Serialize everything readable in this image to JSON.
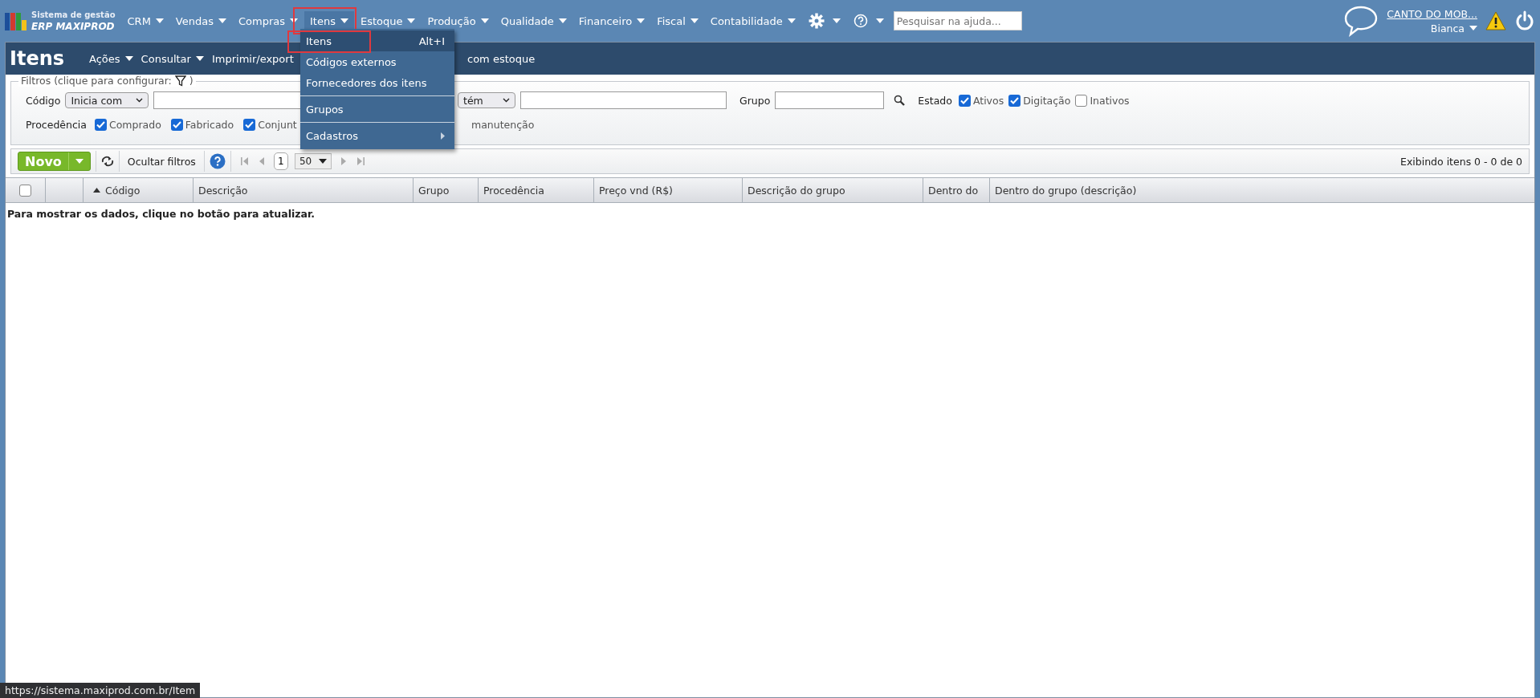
{
  "app": {
    "logo_line1": "Sistema de gestão",
    "logo_line2": "ERP MAXIPROD"
  },
  "top_menu": [
    {
      "label": "CRM",
      "selected": false,
      "annotated": false
    },
    {
      "label": "Vendas",
      "selected": false,
      "annotated": false
    },
    {
      "label": "Compras",
      "selected": false,
      "annotated": false
    },
    {
      "label": "Itens",
      "selected": true,
      "annotated": true
    },
    {
      "label": "Estoque",
      "selected": false,
      "annotated": false
    },
    {
      "label": "Produção",
      "selected": false,
      "annotated": false
    },
    {
      "label": "Qualidade",
      "selected": false,
      "annotated": false
    },
    {
      "label": "Financeiro",
      "selected": false,
      "annotated": false
    },
    {
      "label": "Fiscal",
      "selected": false,
      "annotated": false
    },
    {
      "label": "Contabilidade",
      "selected": false,
      "annotated": false
    }
  ],
  "top_icons": [
    {
      "kind": "gear"
    },
    {
      "kind": "help"
    }
  ],
  "help_search": {
    "placeholder": "Pesquisar na ajuda..."
  },
  "account": {
    "company": "CANTO DO MOB...",
    "user": "Bianca"
  },
  "page": {
    "title": "Itens",
    "actions": [
      {
        "label": "Ações",
        "dropdown": true
      },
      {
        "label": "Consultar",
        "dropdown": true
      },
      {
        "label": "Imprimir/export",
        "dropdown": false
      }
    ],
    "hidden_action_tail": "com estoque"
  },
  "dropdown_menu": [
    {
      "kind": "item",
      "label": "Itens",
      "shortcut": "Alt+I",
      "selected": true,
      "annotated": true
    },
    {
      "kind": "item",
      "label": "Códigos externos",
      "selected": false,
      "annotated": false
    },
    {
      "kind": "item",
      "label": "Fornecedores dos itens",
      "selected": false,
      "annotated": false
    },
    {
      "kind": "separator"
    },
    {
      "kind": "item",
      "label": "Grupos",
      "selected": false,
      "annotated": false
    },
    {
      "kind": "separator"
    },
    {
      "kind": "submenu",
      "label": "Cadastros",
      "selected": false,
      "annotated": false
    }
  ],
  "filters": {
    "legend": "Filtros (clique para configurar:",
    "legend_end": ")",
    "code_label": "Código",
    "code_mode": "Inicia com",
    "desc_mode": "tém",
    "group_label": "Grupo",
    "state_label": "Estado",
    "states": [
      {
        "label": "Ativos",
        "checked": true
      },
      {
        "label": "Digitação",
        "checked": true
      },
      {
        "label": "Inativos",
        "checked": false
      }
    ],
    "origin_label": "Procedência",
    "origins": [
      {
        "label": "Comprado",
        "checked": true
      },
      {
        "label": "Fabricado",
        "checked": true
      },
      {
        "label": "Conjunt",
        "checked": true
      }
    ],
    "origin_tail": "manutenção"
  },
  "toolbar": {
    "new_button": "Novo",
    "hide_filters": "Ocultar filtros",
    "page": "1",
    "page_size": "50",
    "status": "Exibindo itens 0 - 0 de 0"
  },
  "table": {
    "select_all_checked": false,
    "columns": [
      {
        "label": "Código",
        "sorted": true
      },
      {
        "label": "Descrição",
        "sorted": false
      },
      {
        "label": "Grupo",
        "sorted": false
      },
      {
        "label": "Procedência",
        "sorted": false
      },
      {
        "label": "Preço vnd (R$)",
        "sorted": false
      },
      {
        "label": "Descrição do grupo",
        "sorted": false
      },
      {
        "label": "Dentro do",
        "sorted": false
      },
      {
        "label": "Dentro do grupo (descrição)",
        "sorted": false
      }
    ],
    "empty_message": "Para mostrar os dados, clique no botão para atualizar."
  },
  "status_url": "https://sistema.maxiprod.com.br/Item"
}
